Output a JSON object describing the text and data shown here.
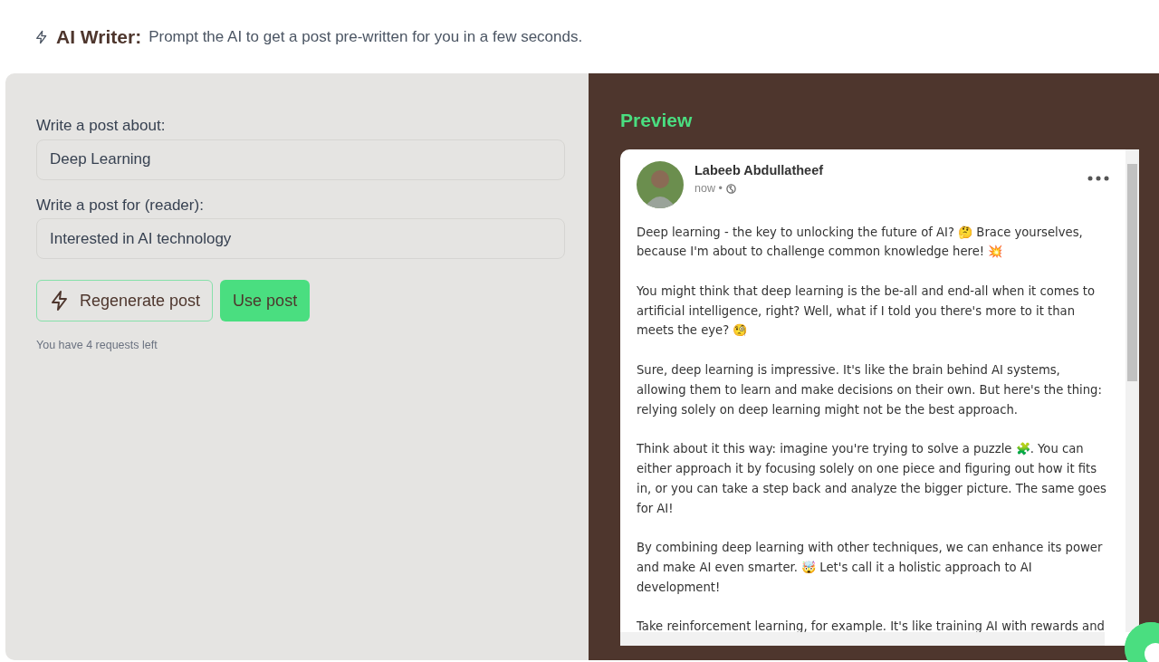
{
  "header": {
    "title": "AI Writer:",
    "subtitle": "Prompt the AI to get a post pre-written for you in a few seconds."
  },
  "form": {
    "fields": [
      {
        "label": "Write a post about:",
        "value": "Deep Learning"
      },
      {
        "label": "Write a post for (reader):",
        "value": "Interested in AI technology"
      }
    ],
    "buttons": [
      {
        "label": "Regenerate post",
        "kind": "outline"
      },
      {
        "label": "Use post",
        "kind": "solid"
      }
    ],
    "note": "You have 4 requests left"
  },
  "preview": {
    "title": "Preview",
    "post": {
      "author": "Labeeb Abdullatheef",
      "time": "now •",
      "paragraphs": [
        "Deep learning - the key to unlocking the future of AI? 🤔 Brace yourselves, because I'm about to challenge common knowledge here! 💥",
        "You might think that deep learning is the be-all and end-all when it comes to artificial intelligence, right? Well, what if I told you there's more to it than meets the eye? 🧐",
        "Sure, deep learning is impressive. It's like the brain behind AI systems, allowing them to learn and make decisions on their own. But here's the thing: relying solely on deep learning might not be the best approach.",
        "Think about it this way: imagine you're trying to solve a puzzle 🧩. You can either approach it by focusing solely on one piece and figuring out how it fits in, or you can take a step back and analyze the bigger picture. The same goes for AI!",
        "By combining deep learning with other techniques, we can enhance its power and make AI even smarter. 🤯 Let's call it a holistic approach to AI development!",
        "Take reinforcement learning, for example. It's like training AI with rewards and"
      ]
    }
  }
}
